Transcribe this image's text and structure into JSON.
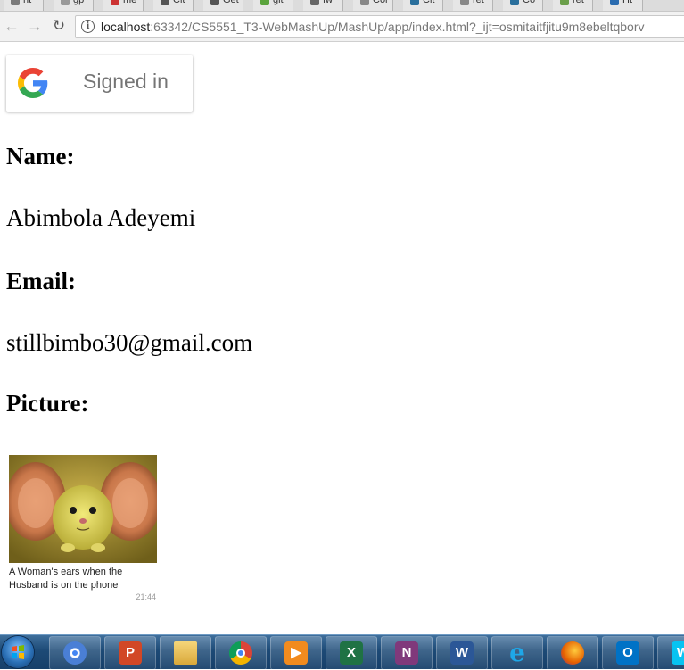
{
  "browser": {
    "tabs": [
      "ht",
      "gp",
      "me",
      "Cit",
      "Get",
      "git",
      "fw",
      "Cor",
      "Cit",
      "ret",
      "Co",
      "ret",
      "Ht"
    ],
    "url_host": "localhost",
    "url_rest": ":63342/CS5551_T3-WebMashUp/MashUp/app/index.html?_ijt=osmitaitfjitu9m8ebeltqborv",
    "icons": {
      "back": "back-arrow-icon",
      "forward": "forward-arrow-icon",
      "reload": "reload-icon",
      "info": "info-icon"
    },
    "info_glyph": "i"
  },
  "google_signin": {
    "label": "Signed in",
    "icon": "google-g-icon"
  },
  "profile": {
    "name_heading": "Name:",
    "name_value": "Abimbola Adeyemi",
    "email_heading": "Email:",
    "email_value": "stillbimbo30@gmail.com",
    "picture_heading": "Picture:"
  },
  "picture": {
    "caption": "A Woman's ears when the Husband is on the phone",
    "time": "21:44"
  },
  "taskbar": {
    "items": [
      {
        "name": "chromium",
        "glyph": "",
        "color": "#4a7fd6"
      },
      {
        "name": "powerpoint",
        "glyph": "P",
        "color": "#d24726"
      },
      {
        "name": "file-explorer",
        "glyph": "",
        "color": "#e8c25b"
      },
      {
        "name": "chrome",
        "glyph": "",
        "color": "#ffffff"
      },
      {
        "name": "media-player",
        "glyph": "▶",
        "color": "#f28b1e"
      },
      {
        "name": "excel",
        "glyph": "X",
        "color": "#1f7244"
      },
      {
        "name": "onenote",
        "glyph": "N",
        "color": "#80397b"
      },
      {
        "name": "word",
        "glyph": "W",
        "color": "#2b5797"
      },
      {
        "name": "internet-explorer",
        "glyph": "e",
        "color": "#1ea7e8"
      },
      {
        "name": "firefox",
        "glyph": "",
        "color": "#e66000"
      },
      {
        "name": "outlook",
        "glyph": "O",
        "color": "#0072c6"
      },
      {
        "name": "webstorm",
        "glyph": "W",
        "color": "#07c3f2"
      }
    ]
  },
  "colors": {
    "google_label": "#757575",
    "taskbar": "#1d4a76"
  }
}
